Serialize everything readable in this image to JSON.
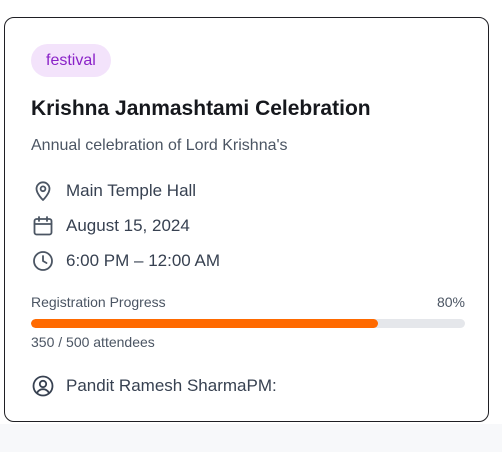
{
  "event": {
    "category": "festival",
    "title": "Krishna Janmashtami Celebration",
    "description": "Annual celebration of Lord Krishna's",
    "location": "Main Temple Hall",
    "date": "August 15, 2024",
    "time": "6:00 PM – 12:00 AM",
    "host": "Pandit Ramesh SharmaPM:"
  },
  "registration": {
    "label": "Registration Progress",
    "percent_label": "80%",
    "progress_fraction": 0.8,
    "attendees_label": "350 / 500 attendees"
  },
  "colors": {
    "badge_bg": "#f3e3fb",
    "badge_text": "#8a22c8",
    "progress_fill": "#ff6a00",
    "progress_track": "#e5e7eb",
    "card_border": "#1f1f24"
  },
  "icons": {
    "location": "map-pin-icon",
    "date": "calendar-icon",
    "time": "clock-icon",
    "host": "user-circle-icon"
  }
}
